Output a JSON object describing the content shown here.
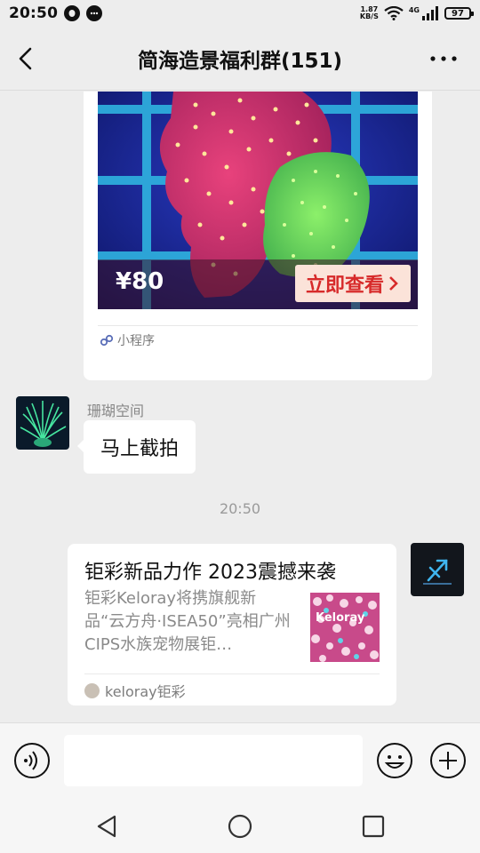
{
  "status_bar": {
    "time": "20:50",
    "net_speed_value": "1.87",
    "net_speed_unit": "KB/S",
    "network_type": "4G",
    "battery": "97"
  },
  "header": {
    "title": "简海造景福利群(151)"
  },
  "messages": {
    "mini_program": {
      "price": "¥80",
      "button_label": "立即查看",
      "source_label": "小程序"
    },
    "text_message": {
      "sender": "珊瑚空间",
      "text": "马上截拍"
    },
    "timestamp": "20:50",
    "article": {
      "title": "钜彩新品力作 2023震撼来袭",
      "description": "钜彩Keloray将携旗舰新品“云方舟·ISEA50”亮相广州CIPS水族宠物展钜…",
      "source": "keloray钜彩",
      "thumb_text": "Keloray"
    }
  },
  "input": {
    "placeholder": "",
    "value": ""
  },
  "colors": {
    "background": "#ededed",
    "bubble": "#ffffff",
    "button_red": "#d72a2a"
  },
  "icons": {
    "back": "chevron-left-icon",
    "more": "more-dots-icon",
    "voice": "voice-icon",
    "emoji": "emoji-icon",
    "plus": "plus-icon",
    "nav_back": "triangle-back-icon",
    "nav_home": "circle-home-icon",
    "nav_recents": "square-recents-icon"
  }
}
